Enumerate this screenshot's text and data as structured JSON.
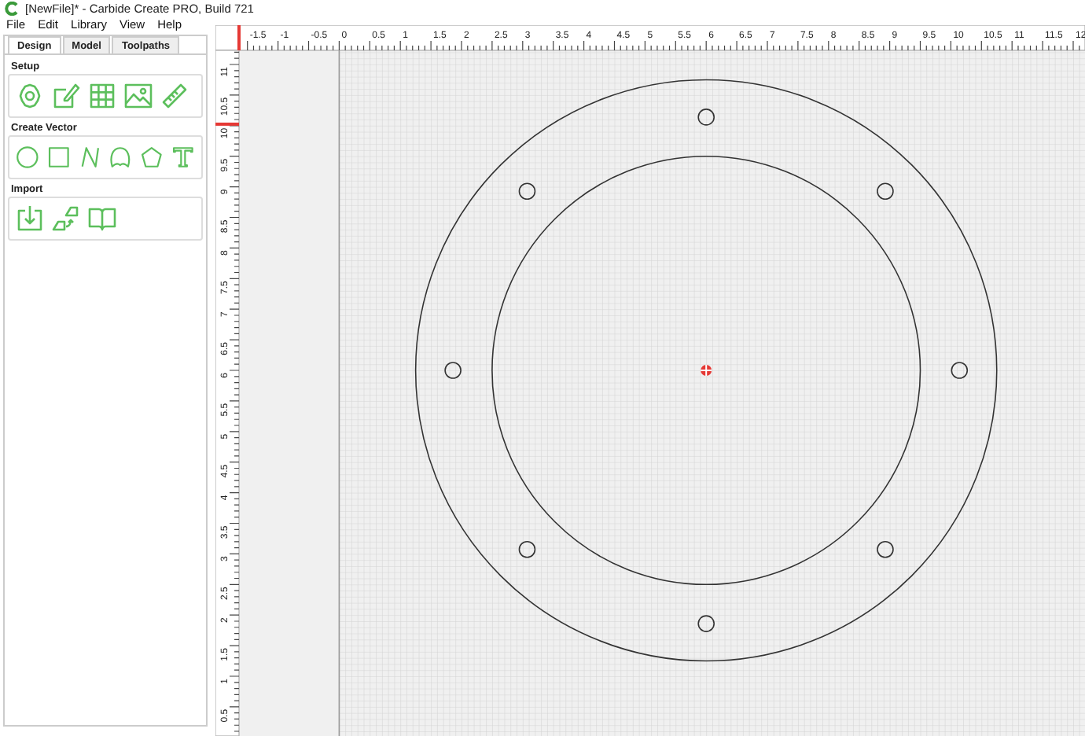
{
  "window": {
    "title": "[NewFile]* - Carbide Create PRO, Build 721"
  },
  "menu": [
    {
      "label": "File"
    },
    {
      "label": "Edit"
    },
    {
      "label": "Library"
    },
    {
      "label": "View"
    },
    {
      "label": "Help"
    }
  ],
  "tabs": [
    {
      "label": "Design",
      "selected": true
    },
    {
      "label": "Model",
      "selected": false
    },
    {
      "label": "Toolpaths",
      "selected": false
    }
  ],
  "sections": [
    {
      "title": "Setup",
      "tools": [
        {
          "kind": "gear"
        },
        {
          "kind": "edit"
        },
        {
          "kind": "grid"
        },
        {
          "kind": "image"
        },
        {
          "kind": "ruler"
        }
      ]
    },
    {
      "title": "Create Vector",
      "tools": [
        {
          "kind": "circle"
        },
        {
          "kind": "square"
        },
        {
          "kind": "curve"
        },
        {
          "kind": "blob"
        },
        {
          "kind": "pentagon"
        },
        {
          "kind": "text"
        }
      ]
    },
    {
      "title": "Import",
      "tools": [
        {
          "kind": "import"
        },
        {
          "kind": "shapes"
        },
        {
          "kind": "book"
        }
      ]
    }
  ],
  "ruler_top": {
    "labels": [
      "-1.5",
      "-1",
      "-0.5",
      "0",
      "0.5",
      "1",
      "1.5",
      "2",
      "2.5",
      "3",
      "3.5",
      "4",
      "4.5",
      "5",
      "5.5",
      "6",
      "6.5",
      "7",
      "7.5",
      "8",
      "8.5",
      "9",
      "9.5",
      "10",
      "10.5",
      "11",
      "11.5",
      "12"
    ]
  },
  "ruler_left": {
    "labels": [
      "11",
      "10.5",
      "10",
      "9.5",
      "9",
      "8.5",
      "8",
      "7.5",
      "7",
      "6.5",
      "6",
      "5.5",
      "5",
      "4.5",
      "4",
      "3.5",
      "3",
      "2.5",
      "2",
      "1.5",
      "1",
      "0.5"
    ]
  }
}
